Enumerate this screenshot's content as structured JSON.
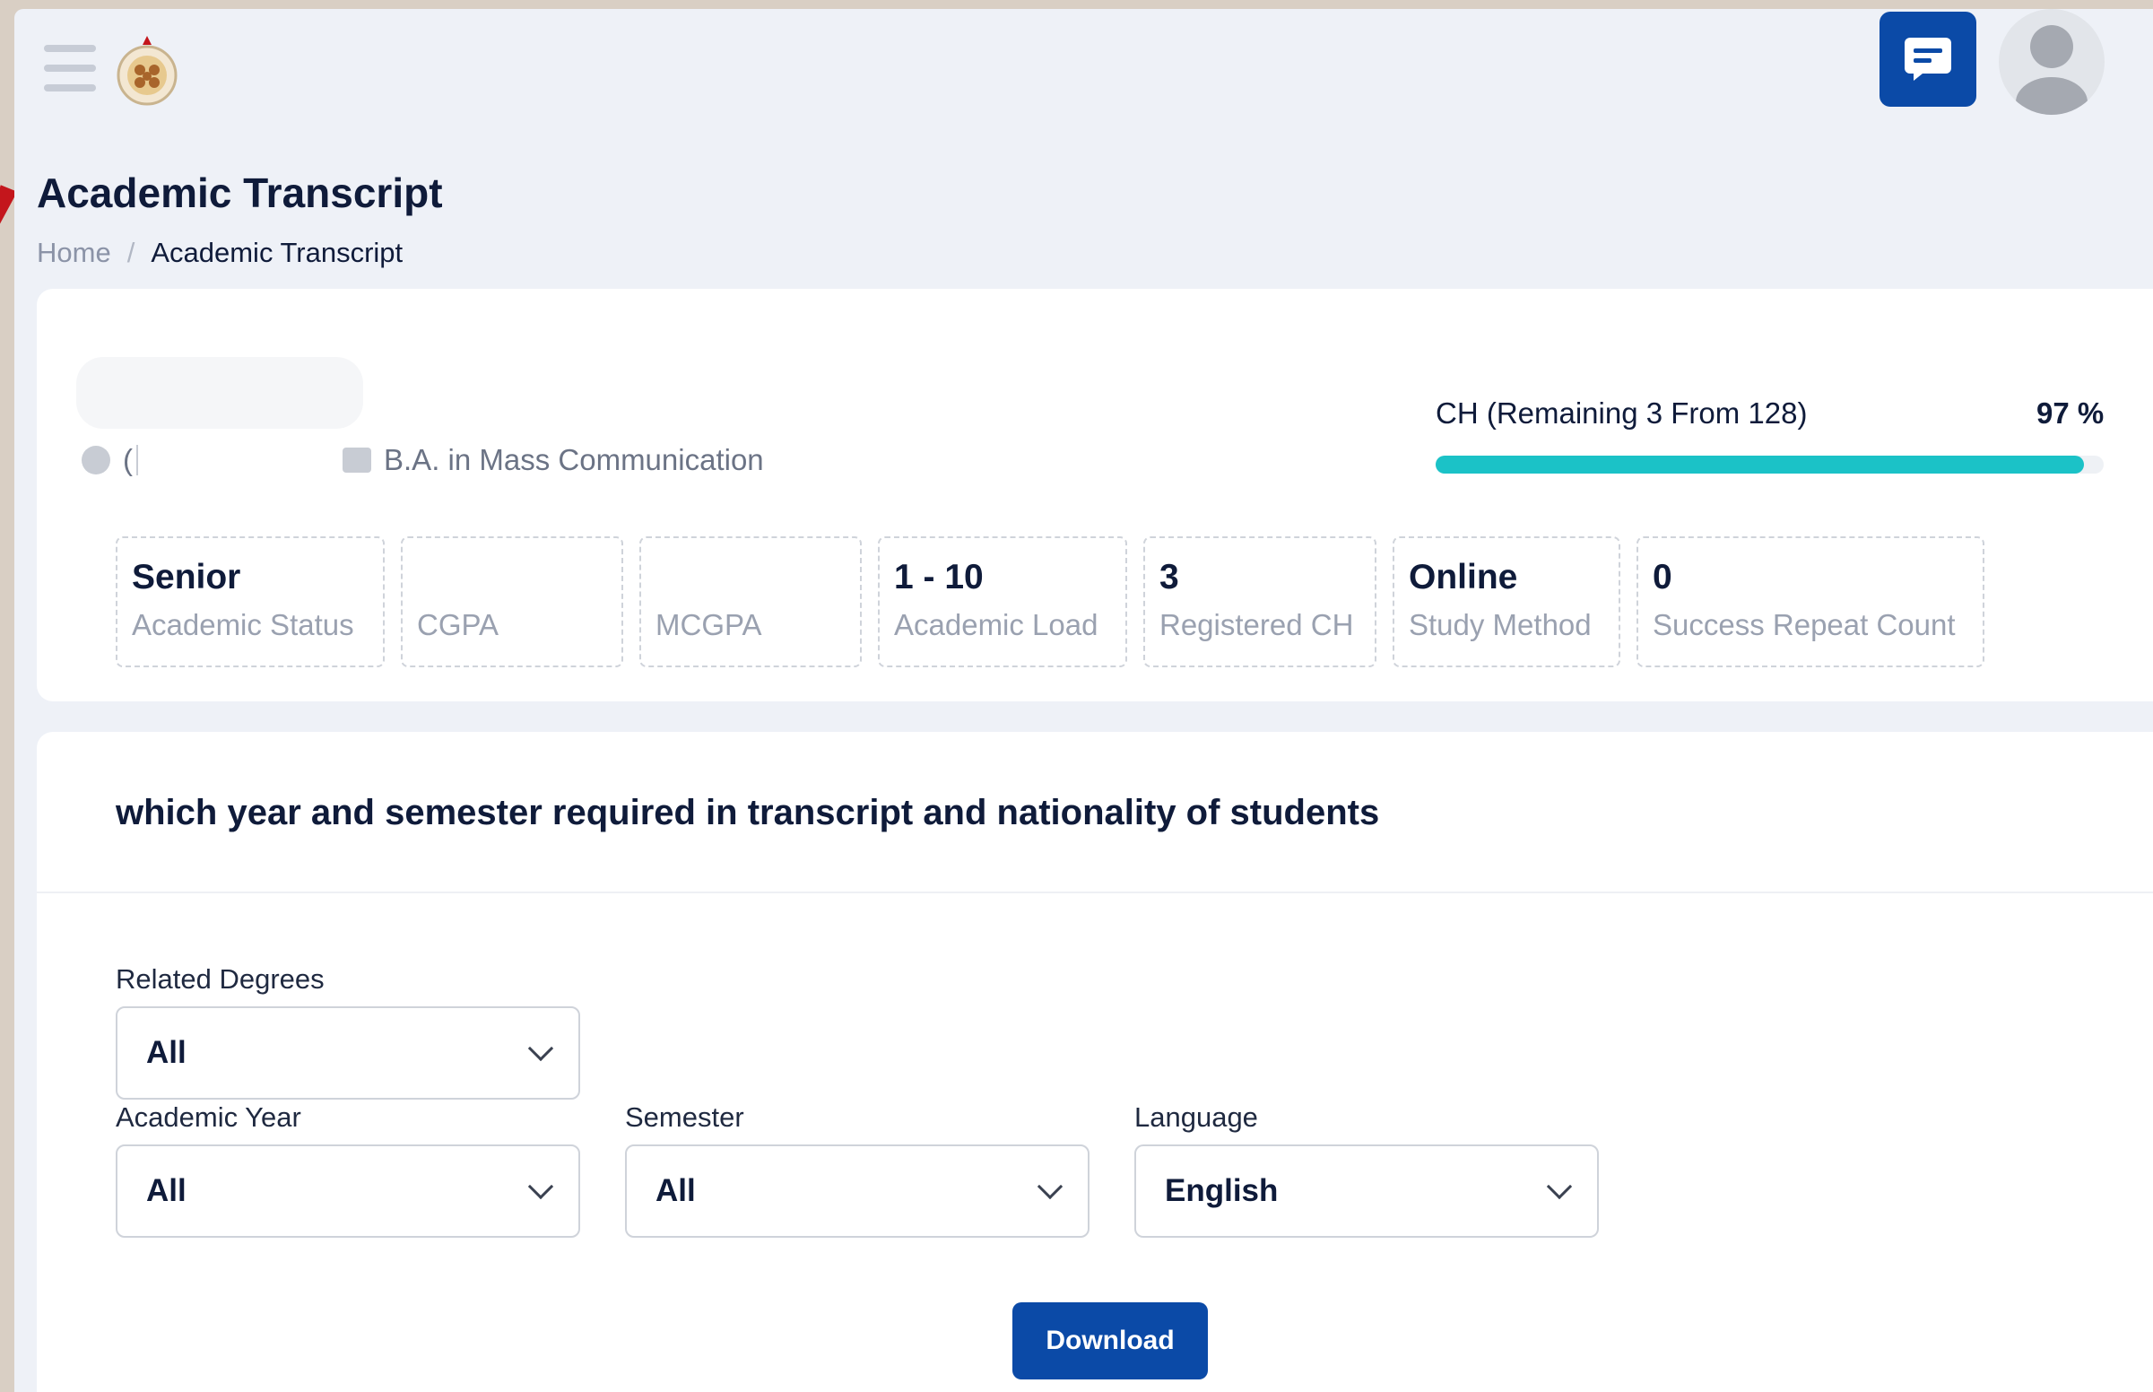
{
  "page": {
    "title": "Academic Transcript",
    "breadcrumb": {
      "home": "Home",
      "separator": "/",
      "current": "Academic Transcript"
    }
  },
  "header": {
    "chat_icon": "message-icon",
    "avatar_icon": "user-avatar-icon"
  },
  "student": {
    "name": "(",
    "degree": "B.A. in Mass Communication"
  },
  "progress": {
    "label": "CH (Remaining 3 From 128)",
    "percent_text": "97 %",
    "percent": 97
  },
  "stats": [
    {
      "value": "Senior",
      "label": "Academic Status"
    },
    {
      "value": "",
      "label": "CGPA"
    },
    {
      "value": "",
      "label": "MCGPA"
    },
    {
      "value": "1 - 10",
      "label": "Academic Load"
    },
    {
      "value": "3",
      "label": "Registered CH"
    },
    {
      "value": "Online",
      "label": "Study Method"
    },
    {
      "value": "0",
      "label": "Success Repeat Count"
    }
  ],
  "form": {
    "question": "which year and semester required in transcript and nationality of students",
    "related_degrees": {
      "label": "Related Degrees",
      "value": "All"
    },
    "academic_year": {
      "label": "Academic Year",
      "value": "All"
    },
    "semester": {
      "label": "Semester",
      "value": "All"
    },
    "language": {
      "label": "Language",
      "value": "English"
    },
    "download_label": "Download"
  },
  "colors": {
    "primary": "#0b4aa7",
    "progress": "#1bc2c7",
    "accent_mark": "#c4161c"
  }
}
